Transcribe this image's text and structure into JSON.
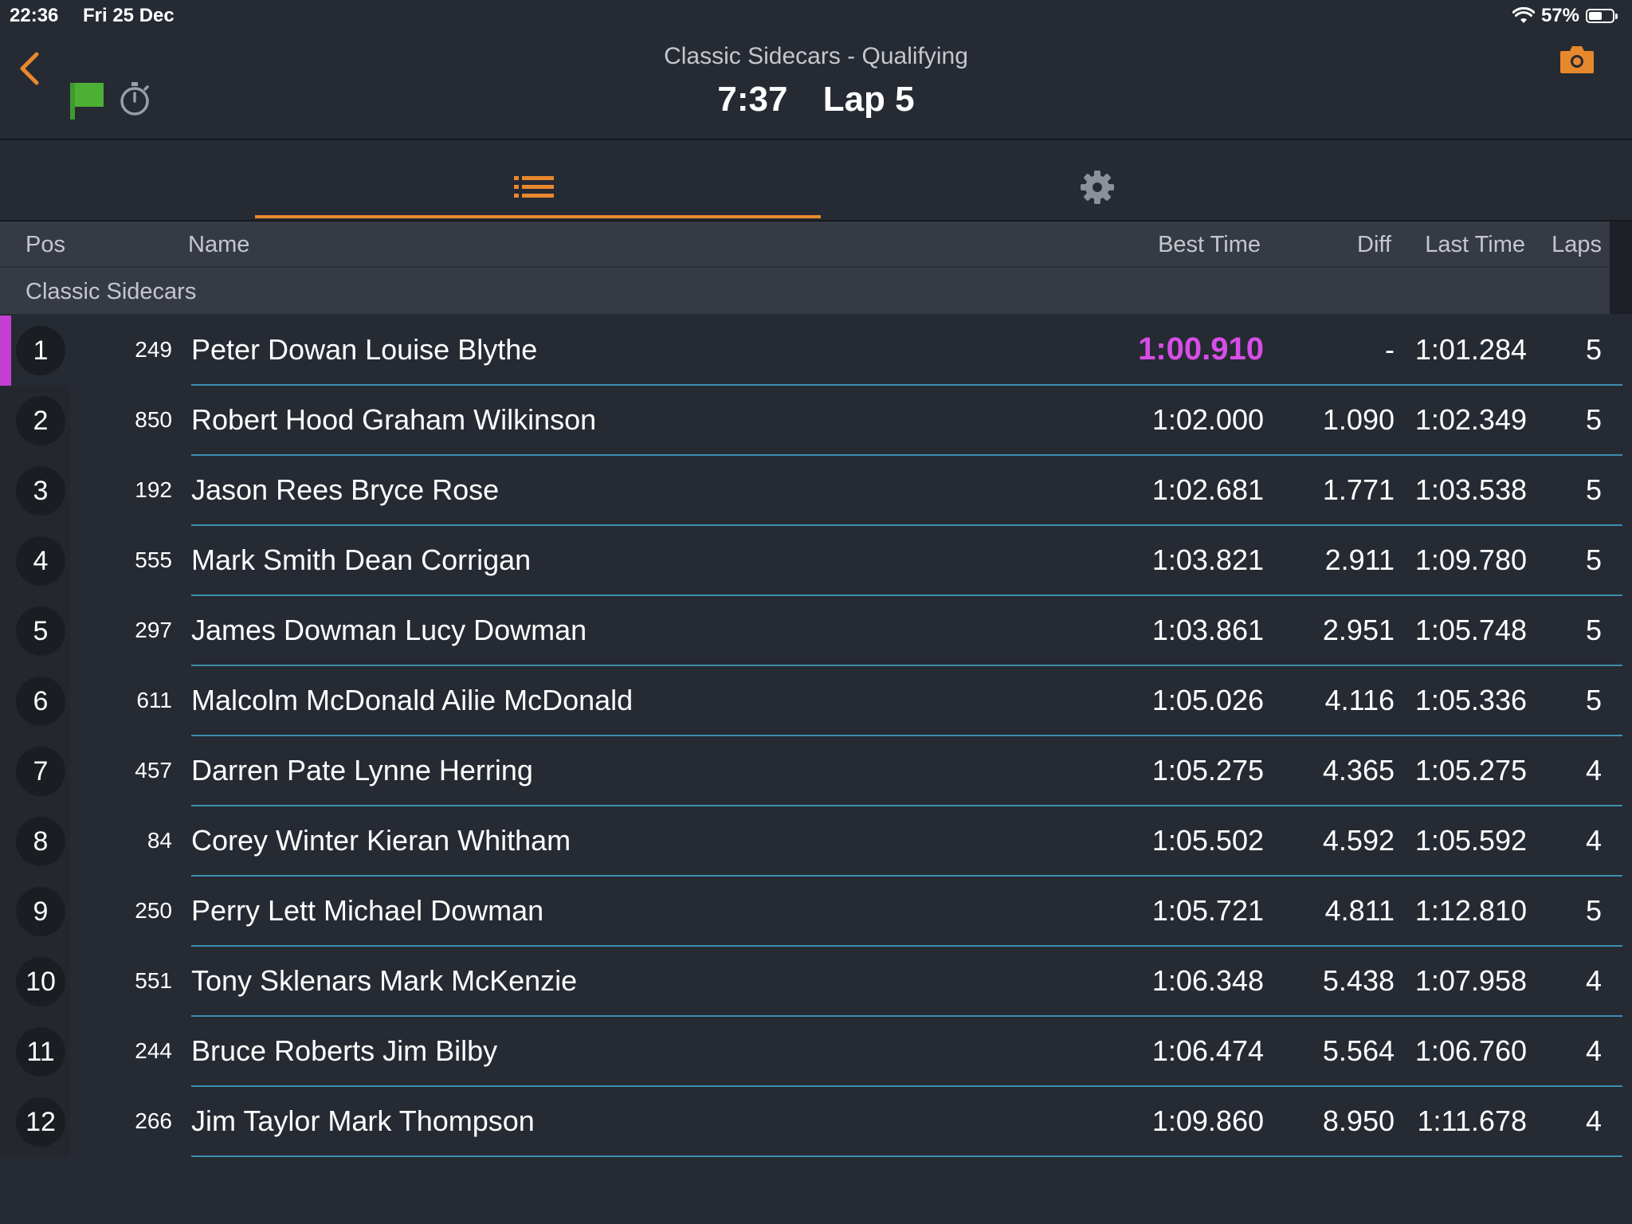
{
  "status_bar": {
    "time": "22:36",
    "date": "Fri 25 Dec",
    "battery": "57%",
    "battery_level": 0.57
  },
  "header": {
    "title": "Classic Sidecars - Qualifying",
    "clock": "7:37",
    "lap": "Lap 5",
    "icons": [
      "back-chevron-icon",
      "green-flag-icon",
      "stopwatch-icon",
      "camera-icon"
    ],
    "accent_color": "#e8882d"
  },
  "tabs": [
    {
      "name": "list",
      "icon": "list-icon",
      "active": true
    },
    {
      "name": "settings",
      "icon": "gear-icon",
      "active": false
    }
  ],
  "table": {
    "columns": {
      "pos": "Pos",
      "name": "Name",
      "best": "Best Time",
      "diff": "Diff",
      "last": "Last Time",
      "laps": "Laps"
    },
    "group": "Classic Sidecars",
    "fastest_color": "#d74ee6",
    "rows": [
      {
        "pos": "1",
        "num": "249",
        "name": "Peter Dowan Louise Blythe",
        "best": "1:00.910",
        "diff": "-",
        "last": "1:01.284",
        "laps": "5",
        "fastest": true
      },
      {
        "pos": "2",
        "num": "850",
        "name": "Robert Hood Graham Wilkinson",
        "best": "1:02.000",
        "diff": "1.090",
        "last": "1:02.349",
        "laps": "5"
      },
      {
        "pos": "3",
        "num": "192",
        "name": "Jason Rees Bryce Rose",
        "best": "1:02.681",
        "diff": "1.771",
        "last": "1:03.538",
        "laps": "5"
      },
      {
        "pos": "4",
        "num": "555",
        "name": "Mark Smith Dean Corrigan",
        "best": "1:03.821",
        "diff": "2.911",
        "last": "1:09.780",
        "laps": "5"
      },
      {
        "pos": "5",
        "num": "297",
        "name": "James Dowman Lucy Dowman",
        "best": "1:03.861",
        "diff": "2.951",
        "last": "1:05.748",
        "laps": "5"
      },
      {
        "pos": "6",
        "num": "611",
        "name": "Malcolm McDonald Ailie McDonald",
        "best": "1:05.026",
        "diff": "4.116",
        "last": "1:05.336",
        "laps": "5"
      },
      {
        "pos": "7",
        "num": "457",
        "name": "Darren Pate Lynne Herring",
        "best": "1:05.275",
        "diff": "4.365",
        "last": "1:05.275",
        "laps": "4"
      },
      {
        "pos": "8",
        "num": "84",
        "name": "Corey Winter Kieran Whitham",
        "best": "1:05.502",
        "diff": "4.592",
        "last": "1:05.592",
        "laps": "4"
      },
      {
        "pos": "9",
        "num": "250",
        "name": "Perry Lett Michael Dowman",
        "best": "1:05.721",
        "diff": "4.811",
        "last": "1:12.810",
        "laps": "5"
      },
      {
        "pos": "10",
        "num": "551",
        "name": "Tony Sklenars Mark McKenzie",
        "best": "1:06.348",
        "diff": "5.438",
        "last": "1:07.958",
        "laps": "4"
      },
      {
        "pos": "11",
        "num": "244",
        "name": "Bruce Roberts Jim Bilby",
        "best": "1:06.474",
        "diff": "5.564",
        "last": "1:06.760",
        "laps": "4"
      },
      {
        "pos": "12",
        "num": "266",
        "name": "Jim Taylor Mark Thompson",
        "best": "1:09.860",
        "diff": "8.950",
        "last": "1:11.678",
        "laps": "4"
      }
    ]
  }
}
